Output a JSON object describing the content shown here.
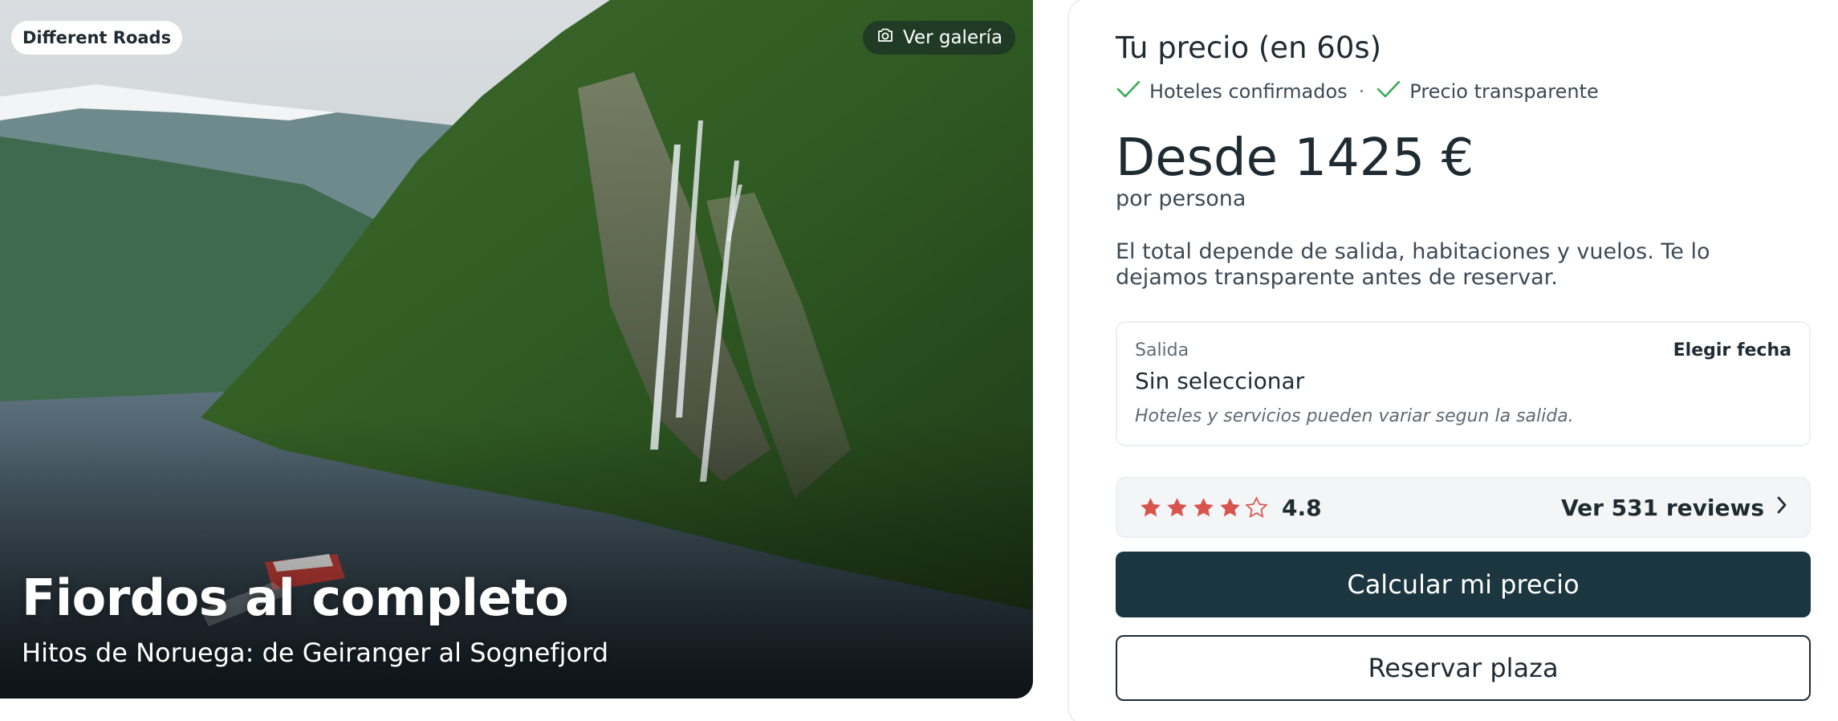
{
  "hero": {
    "brand": "Different Roads",
    "gallery_label": "Ver galería",
    "title": "Fiordos al completo",
    "subtitle": "Hitos de Noruega: de Geiranger al Sognefjord",
    "image_description_icon": "fjord-landscape-photo"
  },
  "panel": {
    "title": "Tu precio (en 60s)",
    "badges": [
      "Hoteles confirmados",
      "Precio transparente"
    ],
    "badge_separator": "·",
    "price": "Desde 1425 €",
    "per_person": "por persona",
    "description": "El total depende de salida, habitaciones y vuelos. Te lo dejamos transparente antes de reservar.",
    "departure": {
      "label": "Salida",
      "value": "Sin seleccionar",
      "choose_label": "Elegir fecha",
      "note": "Hoteles y servicios pueden variar segun la salida."
    },
    "rating": {
      "score": "4.8",
      "stars_filled": 4,
      "stars_total": 5,
      "reviews_label": "Ver 531 reviews"
    },
    "primary_button": "Calcular mi precio",
    "secondary_button": "Reservar plaza"
  },
  "colors": {
    "accent_dark": "#1c3640",
    "check_green": "#3aaa55",
    "star_red": "#d9534f",
    "text": "#1f2b33"
  },
  "icons": [
    "camera-icon",
    "check-icon",
    "star-icon",
    "chevron-right-icon"
  ]
}
